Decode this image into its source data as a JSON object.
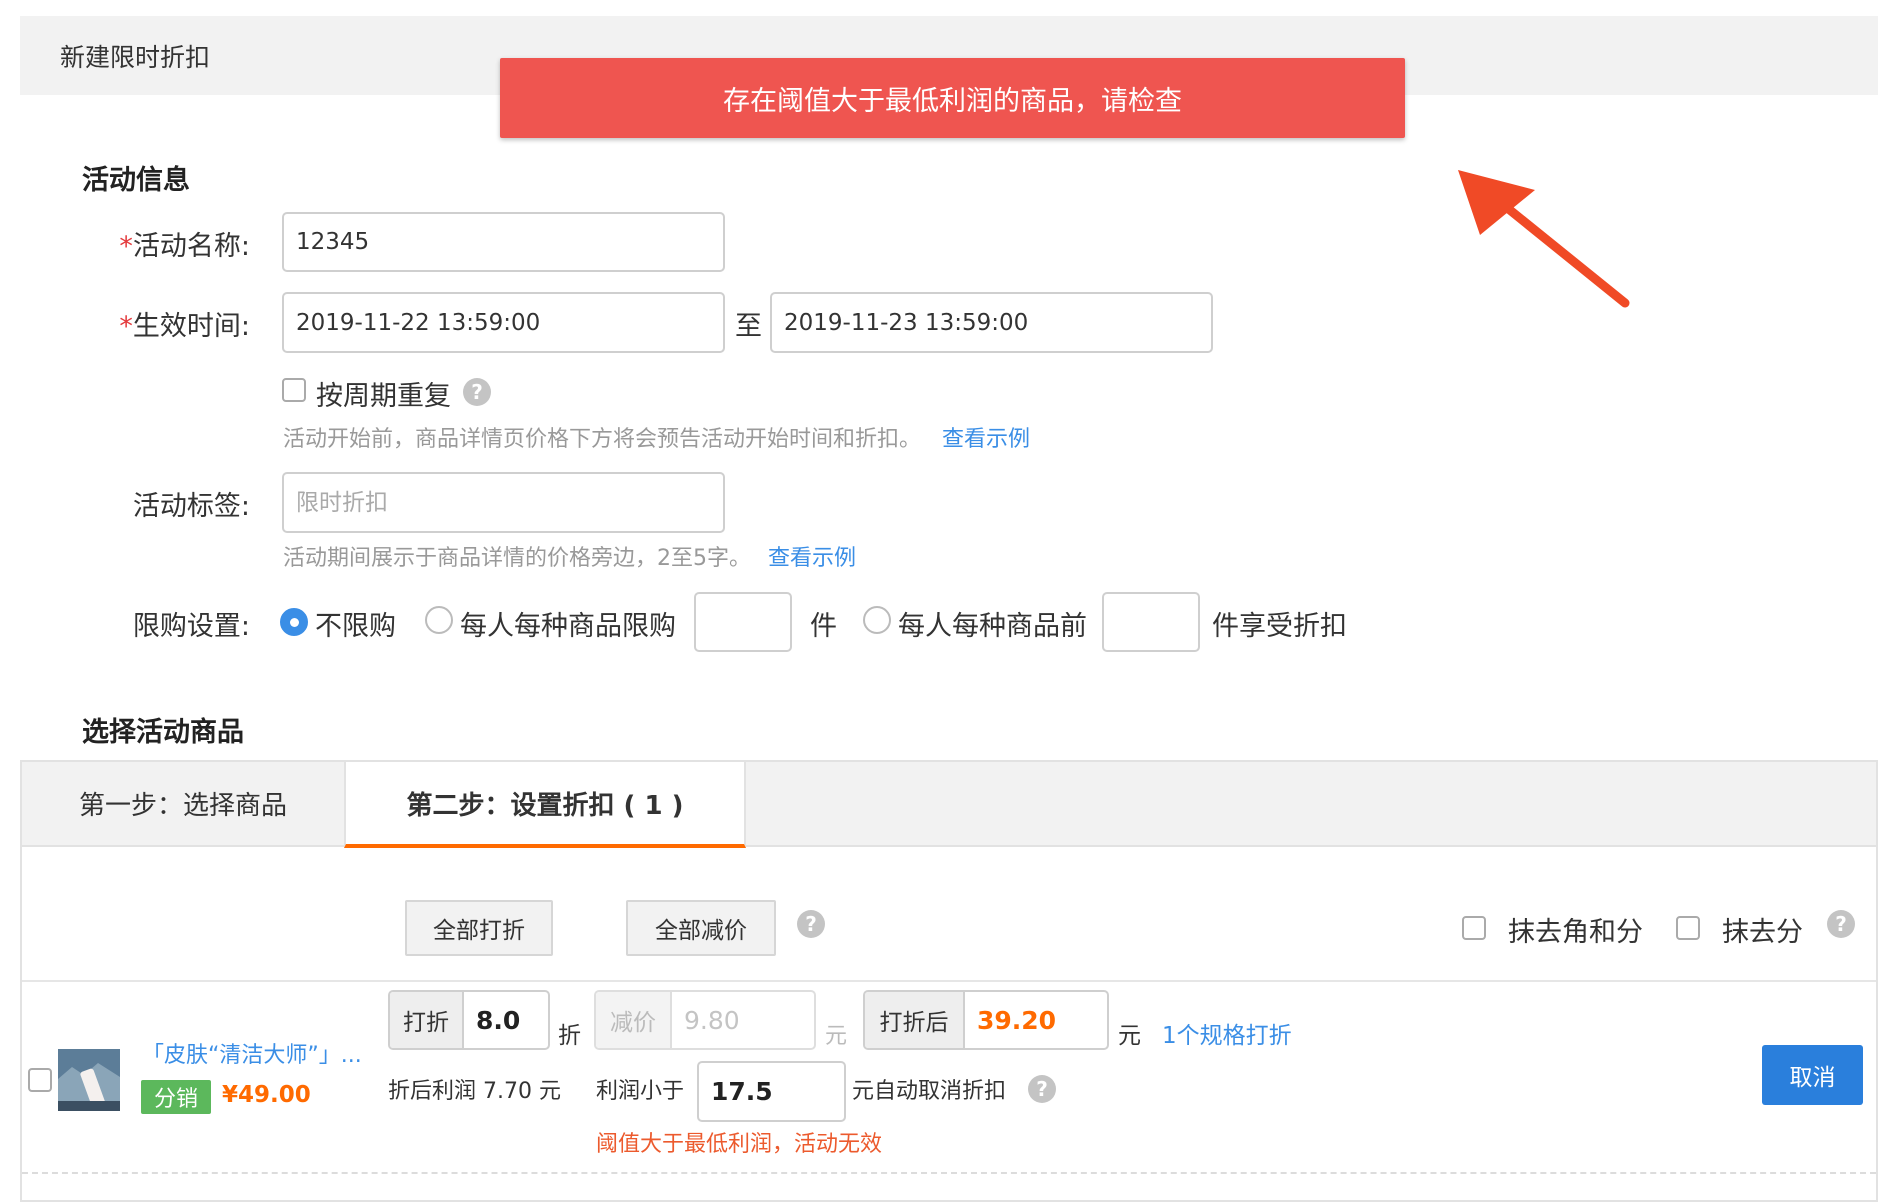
{
  "page_title": "新建限时折扣",
  "toast": {
    "message": "存在阈值大于最低利润的商品，请检查"
  },
  "activity_info": {
    "section_title": "活动信息",
    "name": {
      "required_mark": "*",
      "label": "活动名称:",
      "value": "12345"
    },
    "time": {
      "required_mark": "*",
      "label": "生效时间:",
      "start": "2019-11-22 13:59:00",
      "separator": "至",
      "end": "2019-11-23 13:59:00"
    },
    "repeat": {
      "label": "按周期重复",
      "hint": "活动开始前，商品详情页价格下方将会预告活动开始时间和折扣。",
      "hint_link": "查看示例"
    },
    "tag": {
      "label": "活动标签:",
      "placeholder": "限时折扣",
      "hint": "活动期间展示于商品详情的价格旁边，2至5字。",
      "hint_link": "查看示例"
    },
    "limit": {
      "label": "限购设置:",
      "opt_unlimited": "不限购",
      "opt_per_item": "每人每种商品限购",
      "unit_1": "件",
      "opt_first_n": "每人每种商品前",
      "unit_2": "件享受折扣"
    }
  },
  "select_goods": {
    "section_title": "选择活动商品",
    "tabs": [
      {
        "label": "第一步：选择商品"
      },
      {
        "label": "第二步：设置折扣 ( 1 )"
      }
    ],
    "toolbar": {
      "all_discount": "全部打折",
      "all_reduce": "全部减价",
      "round_jiao_fen": "抹去角和分",
      "round_fen": "抹去分"
    },
    "item": {
      "name": "「皮肤“清洁大师”」...",
      "badge": "分销",
      "price": "¥49.00",
      "discount_label": "打折",
      "discount_value": "8.0",
      "discount_unit": "折",
      "reduce_label": "减价",
      "reduce_value": "9.80",
      "reduce_unit": "元",
      "after_label": "打折后",
      "after_value": "39.20",
      "after_unit": "元",
      "spec_link": "1个规格打折",
      "profit_text": "折后利润 7.70 元",
      "threshold_label": "利润小于",
      "threshold_value": "17.5",
      "threshold_suffix": "元自动取消折扣",
      "error": "阈值大于最低利润，活动无效",
      "cancel": "取消"
    }
  },
  "colors": {
    "toast_bg": "#ef5550",
    "accent_orange": "#ff6a00",
    "link_blue": "#3a8ee6",
    "badge_green": "#5cb85c",
    "arrow_red": "#f04a26"
  }
}
